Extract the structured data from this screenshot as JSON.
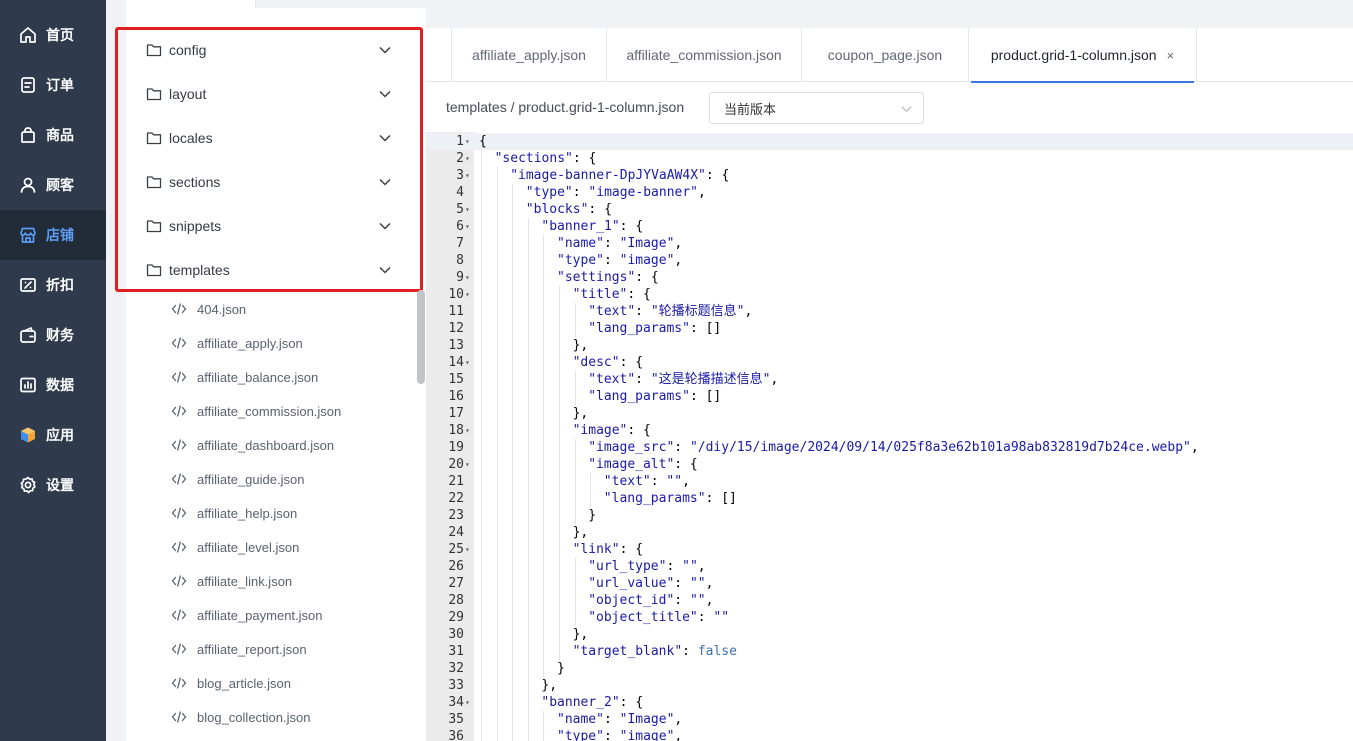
{
  "sidebar": {
    "items": [
      {
        "label": "首页",
        "icon": "home-icon"
      },
      {
        "label": "订单",
        "icon": "order-icon"
      },
      {
        "label": "商品",
        "icon": "product-bag-icon"
      },
      {
        "label": "顾客",
        "icon": "customer-icon"
      },
      {
        "label": "店铺",
        "icon": "store-icon",
        "active": true
      },
      {
        "label": "折扣",
        "icon": "discount-icon"
      },
      {
        "label": "财务",
        "icon": "finance-icon"
      },
      {
        "label": "数据",
        "icon": "data-chart-icon"
      },
      {
        "label": "应用",
        "icon": "apps-cube-icon"
      },
      {
        "label": "设置",
        "icon": "settings-gear-icon"
      }
    ],
    "active_color": "#5b9cf5"
  },
  "tree": {
    "folders": [
      "config",
      "layout",
      "locales",
      "sections",
      "snippets",
      "templates"
    ],
    "files": [
      "404.json",
      "affiliate_apply.json",
      "affiliate_balance.json",
      "affiliate_commission.json",
      "affiliate_dashboard.json",
      "affiliate_guide.json",
      "affiliate_help.json",
      "affiliate_level.json",
      "affiliate_link.json",
      "affiliate_payment.json",
      "affiliate_report.json",
      "blog_article.json",
      "blog_collection.json"
    ]
  },
  "tabs": [
    {
      "label": "affiliate_apply.json"
    },
    {
      "label": "affiliate_commission.json"
    },
    {
      "label": "coupon_page.json"
    },
    {
      "label": "product.grid-1-column.json",
      "active": true,
      "close": "×"
    }
  ],
  "breadcrumb": "templates / product.grid-1-column.json",
  "version_select": "当前版本",
  "code_lines": [
    {
      "n": "1",
      "fold": true,
      "indent": 0,
      "parts": [
        [
          "k",
          "{"
        ]
      ]
    },
    {
      "n": "2",
      "fold": true,
      "indent": 1,
      "parts": [
        [
          "s",
          "\"sections\""
        ],
        [
          "k",
          ": {"
        ]
      ]
    },
    {
      "n": "3",
      "fold": true,
      "indent": 2,
      "parts": [
        [
          "s",
          "\"image-banner-DpJYVaAW4X\""
        ],
        [
          "k",
          ": {"
        ]
      ]
    },
    {
      "n": "4",
      "fold": false,
      "indent": 3,
      "parts": [
        [
          "s",
          "\"type\""
        ],
        [
          "k",
          ": "
        ],
        [
          "s",
          "\"image-banner\""
        ],
        [
          "k",
          ","
        ]
      ]
    },
    {
      "n": "5",
      "fold": true,
      "indent": 3,
      "parts": [
        [
          "s",
          "\"blocks\""
        ],
        [
          "k",
          ": {"
        ]
      ]
    },
    {
      "n": "6",
      "fold": true,
      "indent": 4,
      "parts": [
        [
          "s",
          "\"banner_1\""
        ],
        [
          "k",
          ": {"
        ]
      ]
    },
    {
      "n": "7",
      "fold": false,
      "indent": 5,
      "parts": [
        [
          "s",
          "\"name\""
        ],
        [
          "k",
          ": "
        ],
        [
          "s",
          "\"Image\""
        ],
        [
          "k",
          ","
        ]
      ]
    },
    {
      "n": "8",
      "fold": false,
      "indent": 5,
      "parts": [
        [
          "s",
          "\"type\""
        ],
        [
          "k",
          ": "
        ],
        [
          "s",
          "\"image\""
        ],
        [
          "k",
          ","
        ]
      ]
    },
    {
      "n": "9",
      "fold": true,
      "indent": 5,
      "parts": [
        [
          "s",
          "\"settings\""
        ],
        [
          "k",
          ": {"
        ]
      ]
    },
    {
      "n": "10",
      "fold": true,
      "indent": 6,
      "parts": [
        [
          "s",
          "\"title\""
        ],
        [
          "k",
          ": {"
        ]
      ]
    },
    {
      "n": "11",
      "fold": false,
      "indent": 7,
      "parts": [
        [
          "s",
          "\"text\""
        ],
        [
          "k",
          ": "
        ],
        [
          "s",
          "\"轮播标题信息\""
        ],
        [
          "k",
          ","
        ]
      ]
    },
    {
      "n": "12",
      "fold": false,
      "indent": 7,
      "parts": [
        [
          "s",
          "\"lang_params\""
        ],
        [
          "k",
          ": []"
        ]
      ]
    },
    {
      "n": "13",
      "fold": false,
      "indent": 6,
      "parts": [
        [
          "k",
          "},"
        ]
      ]
    },
    {
      "n": "14",
      "fold": true,
      "indent": 6,
      "parts": [
        [
          "s",
          "\"desc\""
        ],
        [
          "k",
          ": {"
        ]
      ]
    },
    {
      "n": "15",
      "fold": false,
      "indent": 7,
      "parts": [
        [
          "s",
          "\"text\""
        ],
        [
          "k",
          ": "
        ],
        [
          "s",
          "\"这是轮播描述信息\""
        ],
        [
          "k",
          ","
        ]
      ]
    },
    {
      "n": "16",
      "fold": false,
      "indent": 7,
      "parts": [
        [
          "s",
          "\"lang_params\""
        ],
        [
          "k",
          ": []"
        ]
      ]
    },
    {
      "n": "17",
      "fold": false,
      "indent": 6,
      "parts": [
        [
          "k",
          "},"
        ]
      ]
    },
    {
      "n": "18",
      "fold": true,
      "indent": 6,
      "parts": [
        [
          "s",
          "\"image\""
        ],
        [
          "k",
          ": {"
        ]
      ]
    },
    {
      "n": "19",
      "fold": false,
      "indent": 7,
      "parts": [
        [
          "s",
          "\"image_src\""
        ],
        [
          "k",
          ": "
        ],
        [
          "s",
          "\"/diy/15/image/2024/09/14/025f8a3e62b101a98ab832819d7b24ce.webp\""
        ],
        [
          "k",
          ","
        ]
      ]
    },
    {
      "n": "20",
      "fold": true,
      "indent": 7,
      "parts": [
        [
          "s",
          "\"image_alt\""
        ],
        [
          "k",
          ": {"
        ]
      ]
    },
    {
      "n": "21",
      "fold": false,
      "indent": 8,
      "parts": [
        [
          "s",
          "\"text\""
        ],
        [
          "k",
          ": "
        ],
        [
          "s",
          "\"\""
        ],
        [
          "k",
          ","
        ]
      ]
    },
    {
      "n": "22",
      "fold": false,
      "indent": 8,
      "parts": [
        [
          "s",
          "\"lang_params\""
        ],
        [
          "k",
          ": []"
        ]
      ]
    },
    {
      "n": "23",
      "fold": false,
      "indent": 7,
      "parts": [
        [
          "k",
          "}"
        ]
      ]
    },
    {
      "n": "24",
      "fold": false,
      "indent": 6,
      "parts": [
        [
          "k",
          "},"
        ]
      ]
    },
    {
      "n": "25",
      "fold": true,
      "indent": 6,
      "parts": [
        [
          "s",
          "\"link\""
        ],
        [
          "k",
          ": {"
        ]
      ]
    },
    {
      "n": "26",
      "fold": false,
      "indent": 7,
      "parts": [
        [
          "s",
          "\"url_type\""
        ],
        [
          "k",
          ": "
        ],
        [
          "s",
          "\"\""
        ],
        [
          "k",
          ","
        ]
      ]
    },
    {
      "n": "27",
      "fold": false,
      "indent": 7,
      "parts": [
        [
          "s",
          "\"url_value\""
        ],
        [
          "k",
          ": "
        ],
        [
          "s",
          "\"\""
        ],
        [
          "k",
          ","
        ]
      ]
    },
    {
      "n": "28",
      "fold": false,
      "indent": 7,
      "parts": [
        [
          "s",
          "\"object_id\""
        ],
        [
          "k",
          ": "
        ],
        [
          "s",
          "\"\""
        ],
        [
          "k",
          ","
        ]
      ]
    },
    {
      "n": "29",
      "fold": false,
      "indent": 7,
      "parts": [
        [
          "s",
          "\"object_title\""
        ],
        [
          "k",
          ": "
        ],
        [
          "s",
          "\"\""
        ]
      ]
    },
    {
      "n": "30",
      "fold": false,
      "indent": 6,
      "parts": [
        [
          "k",
          "},"
        ]
      ]
    },
    {
      "n": "31",
      "fold": false,
      "indent": 6,
      "parts": [
        [
          "s",
          "\"target_blank\""
        ],
        [
          "k",
          ": "
        ],
        [
          "b",
          "false"
        ]
      ]
    },
    {
      "n": "32",
      "fold": false,
      "indent": 5,
      "parts": [
        [
          "k",
          "}"
        ]
      ]
    },
    {
      "n": "33",
      "fold": false,
      "indent": 4,
      "parts": [
        [
          "k",
          "},"
        ]
      ]
    },
    {
      "n": "34",
      "fold": true,
      "indent": 4,
      "parts": [
        [
          "s",
          "\"banner_2\""
        ],
        [
          "k",
          ": {"
        ]
      ]
    },
    {
      "n": "35",
      "fold": false,
      "indent": 5,
      "parts": [
        [
          "s",
          "\"name\""
        ],
        [
          "k",
          ": "
        ],
        [
          "s",
          "\"Image\""
        ],
        [
          "k",
          ","
        ]
      ]
    },
    {
      "n": "36",
      "fold": false,
      "indent": 5,
      "parts": [
        [
          "s",
          "\"type\""
        ],
        [
          "k",
          ": "
        ],
        [
          "s",
          "\"image\""
        ],
        [
          "k",
          ","
        ]
      ]
    }
  ]
}
